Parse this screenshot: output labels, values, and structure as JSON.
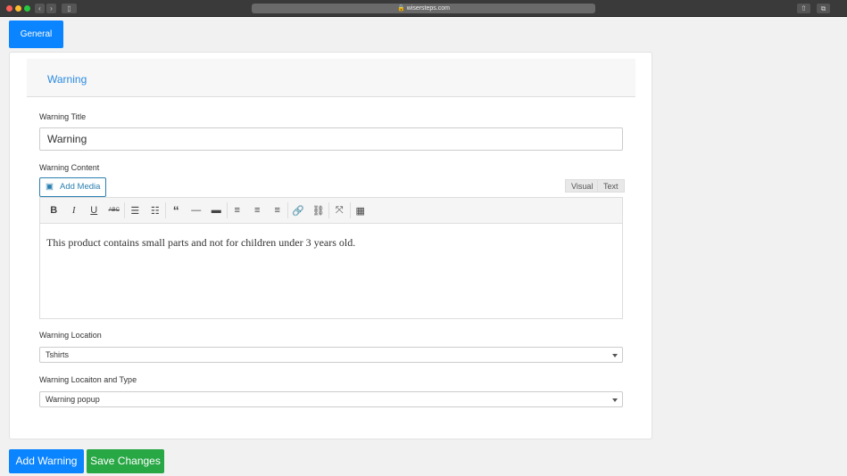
{
  "browser": {
    "url": "wisersteps.com"
  },
  "tab": "General",
  "section": "Warning",
  "title_label": "Warning Title",
  "title_value": "Warning",
  "content_label": "Warning Content",
  "add_media": "Add Media",
  "visual": "Visual",
  "text": "Text",
  "content_text": "This product contains small parts and not for children under 3 years old.",
  "location_label": "Warning Location",
  "location_value": "Tshirts",
  "type_label": "Warning Locaiton and Type",
  "type_value": "Warning popup",
  "add_warning": "Add Warning",
  "save": "Save Changes"
}
